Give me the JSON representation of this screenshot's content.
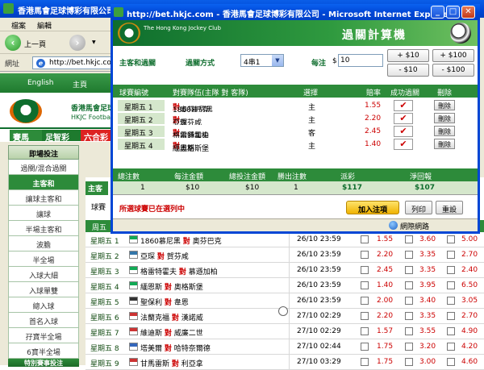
{
  "background": {
    "title": "香港馬會足球博彩有限公司",
    "menu": [
      "檔案",
      "編輯"
    ],
    "back_label": "上一頁",
    "address_label": "網址",
    "address": "http://bet.hkjc.com/",
    "nav": [
      "English",
      "主頁"
    ],
    "banner_line1": "香港馬會足球",
    "banner_line2": "HKJC Football",
    "tabs": [
      "賽馬",
      "足智彩",
      "六合彩"
    ],
    "sidebar_head": "即場投注",
    "sidebar_items": [
      "過關/混合過關",
      "主客和",
      "讓球主客和",
      "讓球",
      "半場主客和",
      "波膽",
      "半全場",
      "入球大細",
      "入球單雙",
      "總入球",
      "首名入球",
      "孖寶半全場",
      "6寶半全場"
    ],
    "sidebar_selected": 1,
    "sidebar_footer": "特別賽事投注",
    "main_type_tab": "主客",
    "main_ball_label": "球賽",
    "main_header": "周五",
    "rows": [
      {
        "day": "星期五 1",
        "home": "1860慕尼黑",
        "vs": "對",
        "away": "奧芬巴克",
        "time": "26/10 23:59",
        "o1": "1.55",
        "o2": "3.60",
        "o3": "5.00"
      },
      {
        "day": "星期五 2",
        "home": "亞琛",
        "vs": "對",
        "away": "賀芬咸",
        "time": "26/10 23:59",
        "o1": "2.20",
        "o2": "3.35",
        "o3": "2.70"
      },
      {
        "day": "星期五 3",
        "home": "格雷特霍夫",
        "vs": "對",
        "away": "慕遜加柏",
        "time": "26/10 23:59",
        "o1": "2.45",
        "o2": "3.35",
        "o3": "2.40"
      },
      {
        "day": "星期五 4",
        "home": "緬恩斯",
        "vs": "對",
        "away": "奧格斯堡",
        "time": "26/10 23:59",
        "o1": "1.40",
        "o2": "3.95",
        "o3": "6.50"
      },
      {
        "day": "星期五 5",
        "home": "聖保利",
        "vs": "對",
        "away": "韋恩",
        "time": "26/10 23:59",
        "o1": "2.00",
        "o2": "3.40",
        "o3": "3.05"
      },
      {
        "day": "星期五 6",
        "home": "法蘭克福",
        "vs": "對",
        "away": "漢諾威",
        "time": "27/10 02:29",
        "o1": "2.20",
        "o2": "3.35",
        "o3": "2.70"
      },
      {
        "day": "星期五 7",
        "home": "維迪斯",
        "vs": "對",
        "away": "威廉二世",
        "time": "27/10 02:29",
        "o1": "1.57",
        "o2": "3.55",
        "o3": "4.90"
      },
      {
        "day": "星期五 8",
        "home": "塔美爾",
        "vs": "對",
        "away": "哈特奈爾德",
        "time": "27/10 02:44",
        "o1": "1.75",
        "o2": "3.20",
        "o3": "4.20"
      },
      {
        "day": "星期五 9",
        "home": "甘馬雷斯",
        "vs": "對",
        "away": "利亞拿",
        "time": "27/10 03:29",
        "o1": "1.75",
        "o2": "3.00",
        "o3": "4.60"
      }
    ]
  },
  "popup": {
    "title": "http://bet.hkjc.com - 香港馬會足球博彩有限公司 - Microsoft Internet Explorer",
    "logo_text": "The Hong Kong Jockey Club",
    "banner_title": "過關計算機",
    "pool_label": "主客和過關",
    "mode_label": "過關方式",
    "mode_value": "4串1",
    "stake_label": "每注",
    "currency": "$",
    "stake_value": "10",
    "adjust": [
      "+ $10",
      "+ $100",
      "- $10",
      "- $100"
    ],
    "sel_headers": [
      "球賽編號",
      "對賽隊伍(主隊 對 客隊)",
      "選擇",
      "賠率",
      "成功過關",
      "刪除"
    ],
    "selections": [
      {
        "day": "星期五 1",
        "home": "1860慕尼黑",
        "vs": "對",
        "away": "奧芬巴克",
        "pick": "主",
        "odds": "1.55",
        "win": "✔",
        "del": "刪除"
      },
      {
        "day": "星期五 2",
        "home": "亞琛",
        "vs": "對",
        "away": "賀芬咸",
        "pick": "主",
        "odds": "2.20",
        "win": "✔",
        "del": "刪除"
      },
      {
        "day": "星期五 3",
        "home": "格雷特霍夫",
        "vs": "對",
        "away": "慕遜加柏",
        "pick": "客",
        "odds": "2.45",
        "win": "✔",
        "del": "刪除"
      },
      {
        "day": "星期五 4",
        "home": "緬恩斯",
        "vs": "對",
        "away": "奧格斯堡",
        "pick": "主",
        "odds": "1.40",
        "win": "✔",
        "del": "刪除"
      }
    ],
    "sum_headers": [
      "總注數",
      "每注金額",
      "總投注金額",
      "勝出注數",
      "派彩",
      "淨回報"
    ],
    "sum_values": [
      "1",
      "$10",
      "$10",
      "1",
      "$117",
      "$107"
    ],
    "warning": "所選球賽已在選列中",
    "add_button": "加入注項",
    "print_button": "列印",
    "reset_button": "重設",
    "status_zone": "網際網路"
  }
}
